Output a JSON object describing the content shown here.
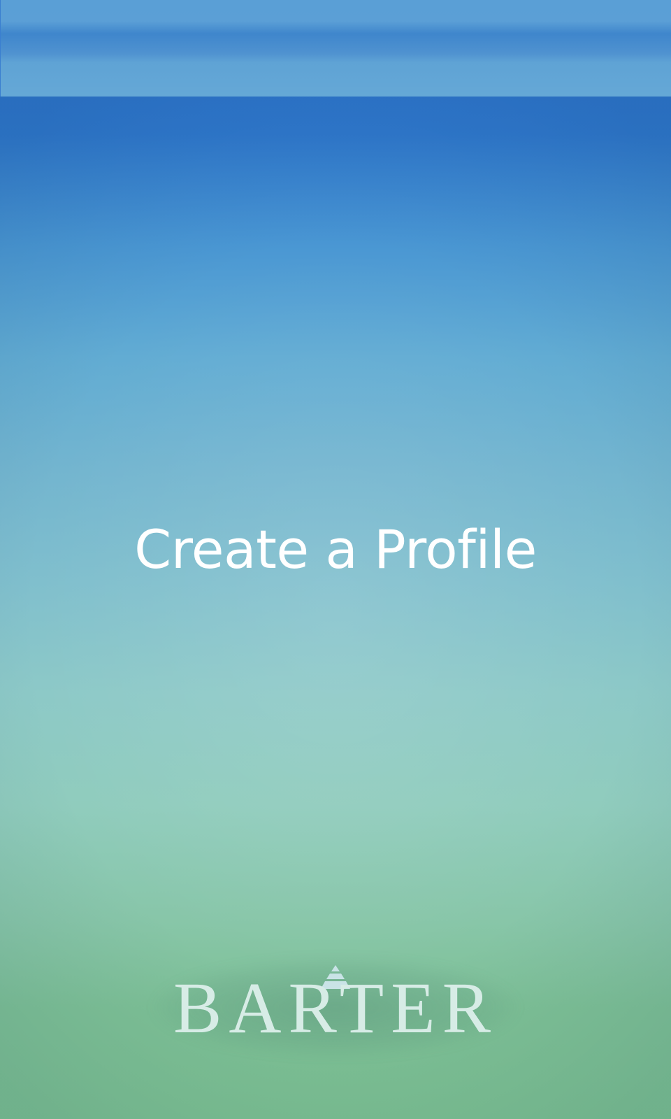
{
  "screen": {
    "title": "Create a Profile"
  },
  "logo": {
    "text": "BARTER",
    "icon": "pyramid-logo-icon"
  },
  "colors": {
    "top_bar": "#5ea1d6",
    "gradient_top": "#2a6fc9",
    "gradient_bottom": "#7dc192",
    "title_text": "#ffffff",
    "logo_text": "#d7ece6"
  }
}
